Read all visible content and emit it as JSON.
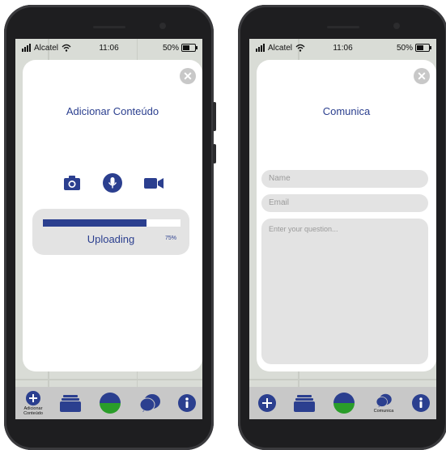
{
  "status_bar": {
    "carrier": "Alcatel",
    "time": "11:06",
    "battery": "50%"
  },
  "left_screen": {
    "title": "Adicionar Conteúdo",
    "close_icon": "close-icon",
    "media_icons": [
      "camera-icon",
      "microphone-icon",
      "video-camera-icon"
    ],
    "upload": {
      "label": "Uploading",
      "percent_text": "75%",
      "progress": 0.75
    },
    "nav": [
      {
        "icon": "plus-circle-icon",
        "label": "Adicionar\nConteúdo"
      },
      {
        "icon": "stack-icon",
        "label": ""
      },
      {
        "icon": "half-circle-icon",
        "label": ""
      },
      {
        "icon": "chat-bubbles-icon",
        "label": ""
      },
      {
        "icon": "info-icon",
        "label": ""
      }
    ]
  },
  "right_screen": {
    "title": "Comunica",
    "close_icon": "close-icon",
    "fields": {
      "name_placeholder": "Name",
      "email_placeholder": "Email",
      "question_placeholder": "Enter your question..."
    },
    "nav": [
      {
        "icon": "plus-circle-icon",
        "label": ""
      },
      {
        "icon": "stack-icon",
        "label": ""
      },
      {
        "icon": "half-circle-icon",
        "label": ""
      },
      {
        "icon": "chat-bubbles-icon",
        "label": "Comunica"
      },
      {
        "icon": "info-icon",
        "label": ""
      }
    ]
  },
  "colors": {
    "brand_blue": "#2b3f8f",
    "accent_green": "#2a9d2a",
    "card_bg": "#ffffff",
    "field_bg": "#e3e3e3",
    "nav_bg": "#c8c8c8"
  }
}
